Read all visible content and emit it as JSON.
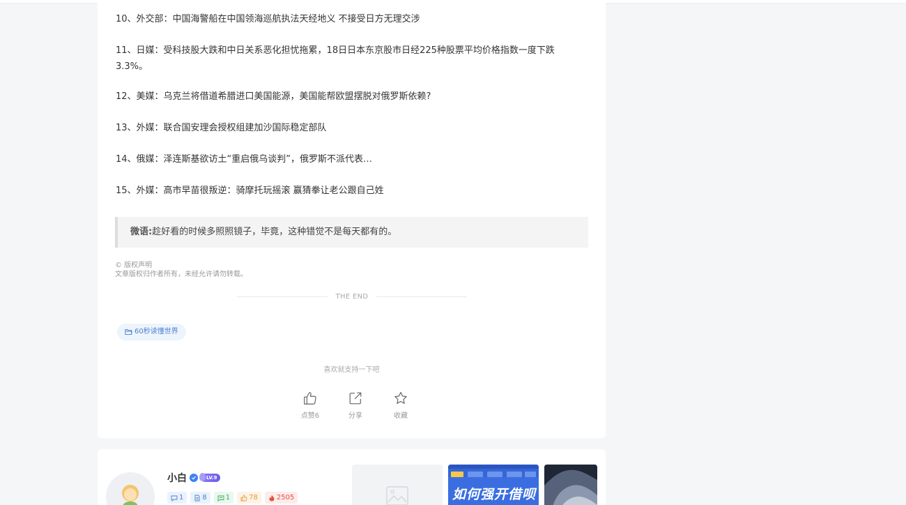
{
  "news": [
    "10、外交部：中国海警船在中国领海巡航执法天经地义 不接受日方无理交涉",
    "11、日媒：受科技股大跌和中日关系恶化担忧拖累，18日日本东京股市日经225种股票平均价格指数一度下跌3.3%。",
    "12、美媒：乌克兰将借道希腊进口美国能源，美国能帮欧盟摆脱对俄罗斯依赖?",
    "13、外媒：联合国安理会授权组建加沙国际稳定部队",
    "14、俄媒：泽连斯基欲访土“重启俄乌谈判”，俄罗斯不派代表…",
    "15、外媒：高市早苗很叛逆：骑摩托玩摇滚 赢猜拳让老公跟自己姓"
  ],
  "quote": {
    "label": "微语:",
    "text": "趁好看的时候多照照镜子，毕竟，这种错觉不是每天都有的。"
  },
  "copyright": {
    "title": "© 版权声明",
    "text": "文章版权归作者所有，未经允许请勿转载。"
  },
  "the_end": "THE END",
  "tag": {
    "icon": "folder-icon",
    "label": "60秒读懂世界"
  },
  "support_text": "喜欢就支持一下吧",
  "actions": {
    "like": "点赞6",
    "share": "分享",
    "favorite": "收藏"
  },
  "author": {
    "name": "小白",
    "level_badge": "LV.9",
    "stats": [
      {
        "icon": "comment-icon",
        "value": "1"
      },
      {
        "icon": "article-icon",
        "value": "8"
      },
      {
        "icon": "message-icon",
        "value": "1"
      },
      {
        "icon": "like-icon",
        "value": "78"
      },
      {
        "icon": "fire-icon",
        "value": "2505"
      }
    ]
  },
  "thumbnails": {
    "second_title": "如何强开借呗"
  },
  "colors": {
    "background": "#f5f6f7",
    "card": "#ffffff",
    "accent_blue": "#4a7fd0",
    "verify_blue": "#3b82f6"
  }
}
